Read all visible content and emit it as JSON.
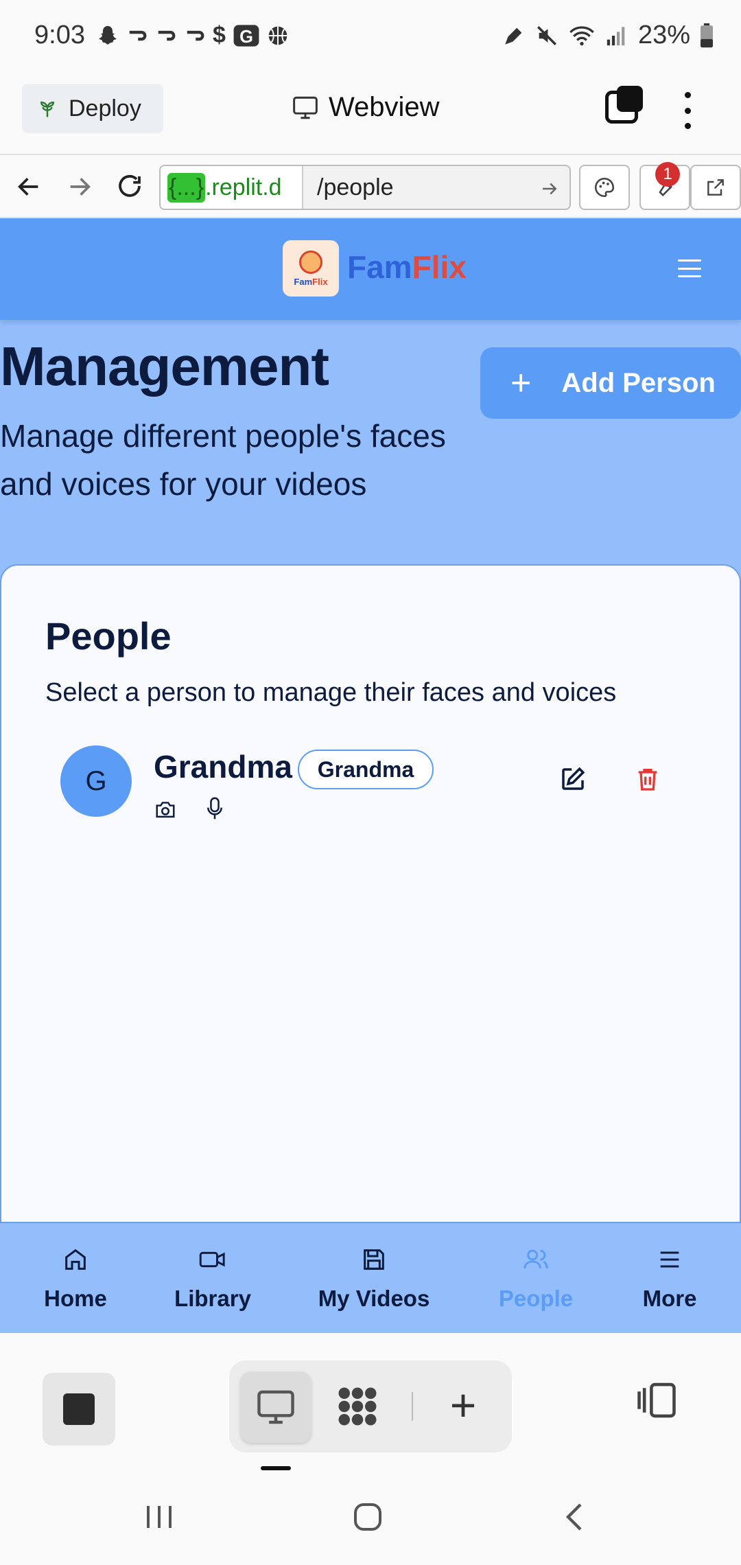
{
  "status_bar": {
    "time": "9:03",
    "battery": "23%",
    "notification_icons": [
      "snapchat-icon",
      "app-icon",
      "app-icon",
      "app-icon",
      "dollar-icon",
      "g-icon",
      "basketball-icon"
    ],
    "system_icons": [
      "pen-icon",
      "mute-icon",
      "wifi-icon",
      "signal-icon",
      "battery-icon"
    ]
  },
  "replit": {
    "deploy_label": "Deploy",
    "webview_label": "Webview",
    "url_host": ".replit.d",
    "url_host_pill": "{...}",
    "url_path": "/people",
    "badge_count": "1"
  },
  "app": {
    "brand_fam": "Fam",
    "brand_flix": "Flix",
    "logo_fam": "Fam",
    "logo_flix": "Flix",
    "page_title": "Management",
    "page_subtitle": "Manage different people's faces and voices for your videos",
    "add_person_label": "Add Person",
    "card": {
      "title": "People",
      "subtitle": "Select a person to manage their faces and voices",
      "people": [
        {
          "initial": "G",
          "name": "Grandma",
          "relation": "Grandma"
        }
      ]
    },
    "bottom_nav": [
      {
        "label": "Home",
        "icon": "home-icon",
        "active": false
      },
      {
        "label": "Library",
        "icon": "video-icon",
        "active": false
      },
      {
        "label": "My Videos",
        "icon": "save-icon",
        "active": false
      },
      {
        "label": "People",
        "icon": "people-icon",
        "active": true
      },
      {
        "label": "More",
        "icon": "menu-icon",
        "active": false
      }
    ]
  },
  "colors": {
    "header_blue": "#5b9cf6",
    "page_blue": "#93bdfb",
    "text_navy": "#0d1b3e",
    "delete_red": "#e53935",
    "brand_red": "#e04a3f"
  }
}
